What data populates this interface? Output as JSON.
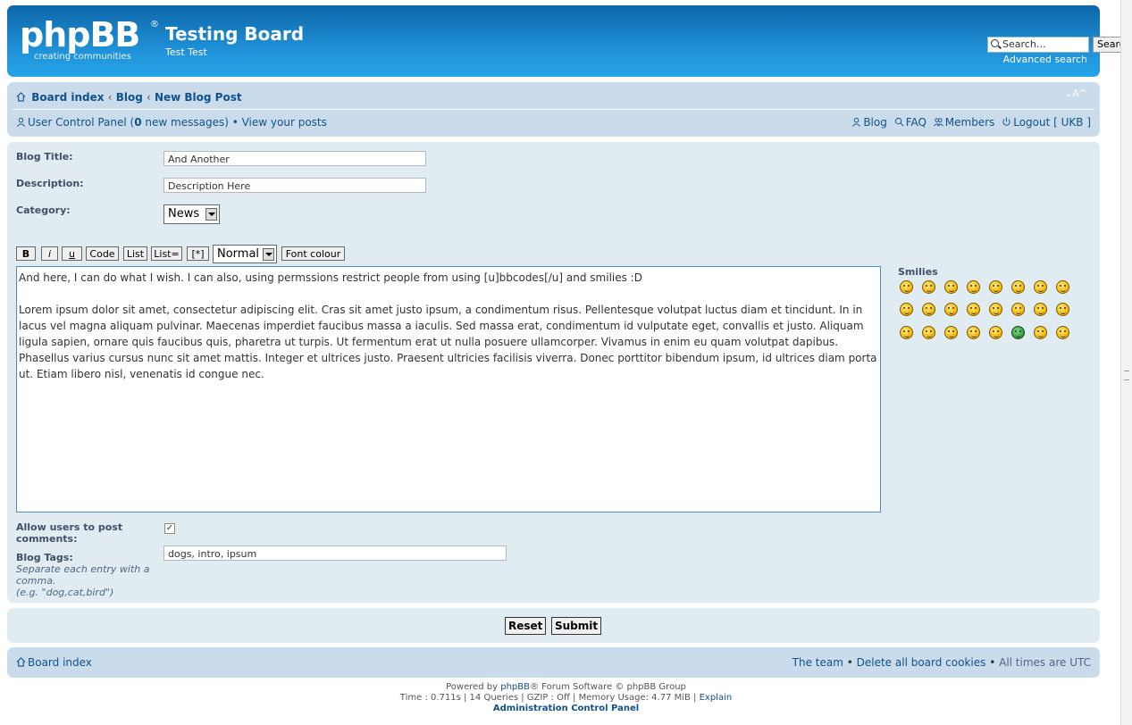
{
  "header": {
    "logo_main": "phpBB",
    "logo_reg": "®",
    "logo_tagline": "creating  communities",
    "site_title": "Testing Board",
    "site_description": "Test Test",
    "search_placeholder": "Search…",
    "search_button": "Search",
    "advanced_search": "Advanced search"
  },
  "navbar": {
    "crumbs": [
      "Board index",
      "Blog",
      "New Blog Post"
    ],
    "crumb_sep": "‹",
    "font_size": "⌄A^",
    "ucp_label": "User Control Panel (",
    "new_count": "0",
    "new_messages": " new messages)",
    "bullet": " • ",
    "view_posts": "View your posts",
    "links": [
      "Blog",
      "FAQ",
      "Members",
      "Logout [ UKB ]"
    ]
  },
  "form": {
    "blog_title_label": "Blog Title:",
    "blog_title_value": "And Another",
    "description_label": "Description:",
    "description_value": "Description Here",
    "category_label": "Category:",
    "category_value": "News",
    "toolbar": [
      "B",
      "i",
      "u",
      "Code",
      "List",
      "List=",
      "[*]"
    ],
    "font_size_select": "Normal",
    "font_colour": "Font colour",
    "message_line1": "And here, I can do what I wish. I can also, using permssions restrict people from using [u]bbcodes[/u] and smilies  :D",
    "message_body": "Lorem ipsum dolor sit amet, consectetur adipiscing elit. Cras sit amet justo ipsum, a condimentum risus. Pellentesque volutpat luctus diam et tincidunt. In in lacus vel magna aliquam pulvinar. Maecenas imperdiet faucibus massa a iaculis. Sed massa erat, condimentum id vulputate eget, convallis et justo. Aliquam ligula sapien, ornare quis faucibus quis, pharetra ut turpis. Ut fermentum erat ut nulla posuere ullamcorper. Vivamus in enim eu quam volutpat dapibus. Phasellus varius cursus nunc sit amet mattis. Integer et ultrices justo. Praesent ultricies facilisis viverra. Donec porttitor bibendum ipsum, id ultrices diam porta ut. Etiam libero nisl, venenatis id congue nec.",
    "smilies_label": "Smilies",
    "allow_comments_label": "Allow users to post comments:",
    "allow_comments_checked": true,
    "tags_label": "Blog Tags:",
    "tags_hint": "Separate each entry with a comma.",
    "tags_example": "(e.g. \"dog,cat,bird\")",
    "tags_value": "dogs, intro, ipsum"
  },
  "buttons": {
    "reset": "Reset",
    "submit": "Submit"
  },
  "footer": {
    "board_index": "Board index",
    "the_team": "The team",
    "delete_cookies": "Delete all board cookies",
    "times": "All times are UTC",
    "bullet": " • ",
    "powered_pre": "Powered by ",
    "powered_link": "phpBB",
    "powered_post": "® Forum Software © phpBB Group",
    "stats": "Time : 0.711s | 14 Queries | GZIP : Off | Memory Usage: 4.77 MiB | ",
    "explain": "Explain",
    "acp": "Administration Control Panel"
  },
  "colors": {
    "header_blue": "#1f8fd6",
    "link": "#105289",
    "panel": "#e1ebf2",
    "navbar": "#cadceb"
  }
}
